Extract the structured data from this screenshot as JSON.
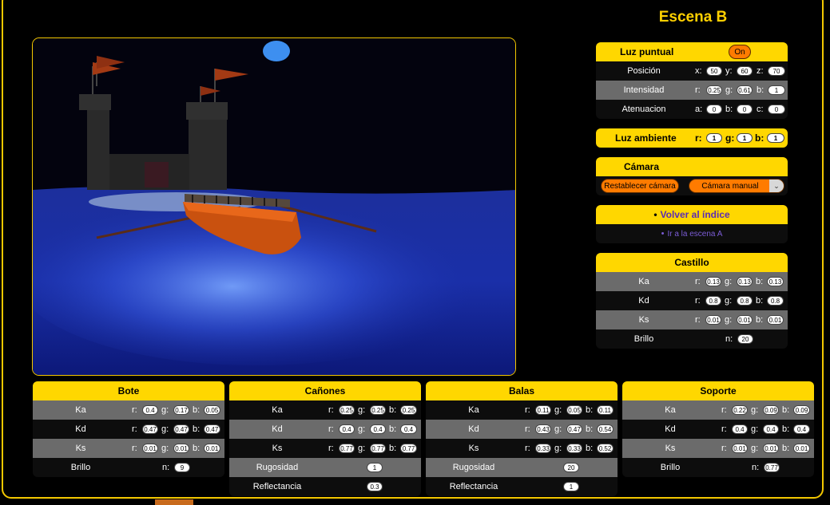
{
  "title": "Escena B",
  "luz_puntual": {
    "title": "Luz puntual",
    "toggle": "On",
    "posicion": {
      "label": "Posición",
      "x": "50",
      "y": "60",
      "z": "70"
    },
    "intensidad": {
      "label": "Intensidad",
      "r": "0.25",
      "g": "0.61",
      "b": "1"
    },
    "atenuacion": {
      "label": "Atenuacion",
      "a": "0",
      "b": "0",
      "c": "0"
    }
  },
  "luz_ambiente": {
    "title": "Luz ambiente",
    "r": "1",
    "g": "1",
    "b": "1"
  },
  "camara": {
    "title": "Cámara",
    "reset": "Restablecer cámara",
    "mode": "Cámara manual"
  },
  "nav": {
    "back": "Volver al índice",
    "scene_a": "Ir a la escena A"
  },
  "castillo": {
    "title": "Castillo",
    "rows": [
      {
        "label": "Ka",
        "r": "0.13",
        "g": "0.13",
        "b": "0.13"
      },
      {
        "label": "Kd",
        "r": "0.8",
        "g": "0.8",
        "b": "0.8"
      },
      {
        "label": "Ks",
        "r": "0.01",
        "g": "0.01",
        "b": "0.01"
      }
    ],
    "brillo": {
      "label": "Brillo",
      "n": "20"
    }
  },
  "bote": {
    "title": "Bote",
    "rows": [
      {
        "label": "Ka",
        "r": "0.4",
        "g": "0.17",
        "b": "0.05"
      },
      {
        "label": "Kd",
        "r": "0.47",
        "g": "0.47",
        "b": "0.47"
      },
      {
        "label": "Ks",
        "r": "0.01",
        "g": "0.01",
        "b": "0.01"
      }
    ],
    "brillo": {
      "label": "Brillo",
      "n": "9"
    }
  },
  "canones": {
    "title": "Cañones",
    "rows": [
      {
        "label": "Ka",
        "r": "0.25",
        "g": "0.25",
        "b": "0.25"
      },
      {
        "label": "Kd",
        "r": "0.4",
        "g": "0.4",
        "b": "0.4"
      },
      {
        "label": "Ks",
        "r": "0.77",
        "g": "0.77",
        "b": "0.77"
      }
    ],
    "rugosidad": {
      "label": "Rugosidad",
      "value": "1"
    },
    "reflectancia": {
      "label": "Reflectancia",
      "value": "0.3"
    }
  },
  "balas": {
    "title": "Balas",
    "rows": [
      {
        "label": "Ka",
        "r": "0.11",
        "g": "0.05",
        "b": "0.11"
      },
      {
        "label": "Kd",
        "r": "0.43",
        "g": "0.47",
        "b": "0.54"
      },
      {
        "label": "Ks",
        "r": "0.33",
        "g": "0.33",
        "b": "0.52"
      }
    ],
    "rugosidad": {
      "label": "Rugosidad",
      "value": "20"
    },
    "reflectancia": {
      "label": "Reflectancia",
      "value": "1"
    }
  },
  "soporte": {
    "title": "Soporte",
    "rows": [
      {
        "label": "Ka",
        "r": "0.22",
        "g": "0.09",
        "b": "0.09"
      },
      {
        "label": "Kd",
        "r": "0.4",
        "g": "0.4",
        "b": "0.4"
      },
      {
        "label": "Ks",
        "r": "0.01",
        "g": "0.01",
        "b": "0.01"
      }
    ],
    "brillo": {
      "label": "Brillo",
      "n": "0.77"
    }
  },
  "colors": {
    "accent": "#ffd700",
    "border": "#f3c700",
    "button": "#ff7b00",
    "row_gray": "#6b6b6b"
  }
}
